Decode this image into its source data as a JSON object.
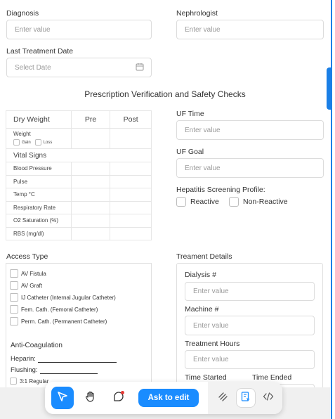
{
  "form": {
    "diagnosis": {
      "label": "Diagnosis",
      "placeholder": "Enter value"
    },
    "nephrologist": {
      "label": "Nephrologist",
      "placeholder": "Enter value"
    },
    "last_treatment_date": {
      "label": "Last Treatment Date",
      "placeholder": "Select Date"
    }
  },
  "section_title": "Prescription Verification and Safety Checks",
  "prescription_table": {
    "headers": [
      "Dry Weight",
      "Pre",
      "Post"
    ],
    "weight_label": "Weight",
    "gain_label": "Gain",
    "loss_label": "Loss",
    "vital_signs_label": "Vital Signs",
    "rows": [
      "Blood Pressure",
      "Pulse",
      "Temp °C",
      "Respiratory Rate",
      "O2 Saturation (%)",
      "RBS (mg/dl)"
    ]
  },
  "uf_time": {
    "label": "UF Time",
    "placeholder": "Enter value"
  },
  "uf_goal": {
    "label": "UF Goal",
    "placeholder": "Enter value"
  },
  "hepatitis": {
    "label": "Hepatitis Screening Profile:",
    "options": [
      "Reactive",
      "Non-Reactive"
    ]
  },
  "access_type": {
    "label": "Access Type",
    "options": [
      "AV Fistula",
      "AV Graft",
      "IJ Catheter (Internal Jugular Catheter)",
      "Fem. Cath. (Femoral Catheter)",
      "Perm. Cath. (Permanent Catheter)"
    ],
    "anti_coagulation_label": "Anti-Coagulation",
    "heparin_label": "Heparin:",
    "flushing_label": "Flushing:",
    "ratio_option": "3:1 Regular"
  },
  "treatment_details": {
    "label": "Treament Details",
    "dialysis": {
      "label": "Dialysis #",
      "placeholder": "Enter value"
    },
    "machine": {
      "label": "Machine #",
      "placeholder": "Enter value"
    },
    "hours": {
      "label": "Treatment Hours",
      "placeholder": "Enter value"
    },
    "time_started_label": "Time Started",
    "time_ended_label": "Time Ended"
  },
  "toolbar": {
    "ask_to_edit": "Ask to edit",
    "accent_color": "#1a8cff",
    "icons": [
      "pointer-icon",
      "hand-icon",
      "comment-icon",
      "draw-icon",
      "form-icon",
      "code-icon"
    ]
  }
}
